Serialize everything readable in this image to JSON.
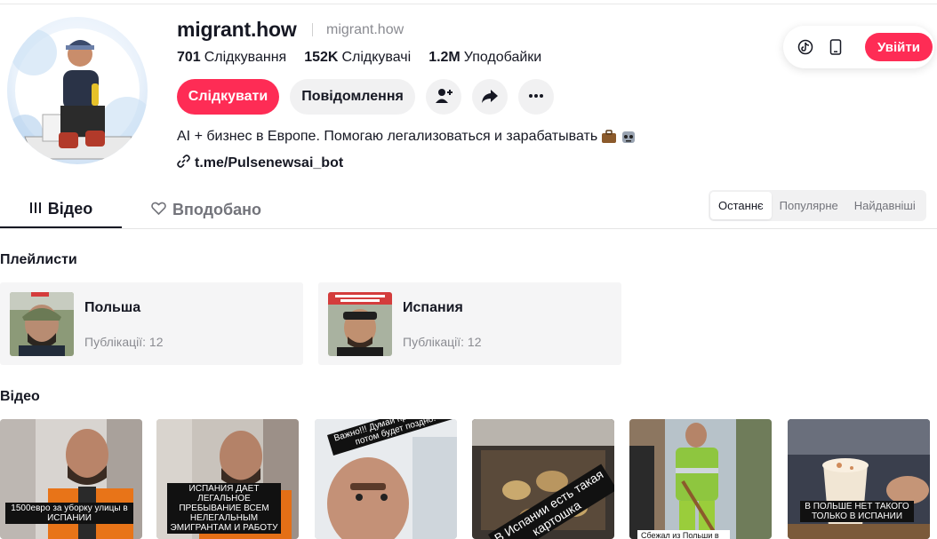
{
  "profile": {
    "username": "migrant.how",
    "nickname": "migrant.how",
    "stats": {
      "following_value": "701",
      "following_label": "Слідкування",
      "followers_value": "152K",
      "followers_label": "Слідкувачі",
      "likes_value": "1.2M",
      "likes_label": "Уподобайки"
    },
    "follow_label": "Слідкувати",
    "message_label": "Повідомлення",
    "bio": "AI + бизнес в Европе. Помогаю легализоваться и зарабатывать",
    "link": "t.me/Pulsenewsai_bot"
  },
  "header": {
    "login_label": "Увійти"
  },
  "tabs": {
    "videos": "Відео",
    "liked": "Вподобано"
  },
  "sort": {
    "latest": "Останнє",
    "popular": "Популярне",
    "oldest": "Найдавніші"
  },
  "sections": {
    "playlists": "Плейлисти",
    "videos": "Відео"
  },
  "playlists": [
    {
      "name": "Польша",
      "count": "Публікації: 12"
    },
    {
      "name": "Испания",
      "count": "Публікації: 12"
    }
  ],
  "videos": [
    {
      "caption": "1500евро за уборку улицы в ИСПАНИИ"
    },
    {
      "caption": "ИСПАНИЯ ДАЕТ ЛЕГАЛЬНОЕ ПРЕБЫВАНИЕ ВСЕМ НЕЛЕГАЛЬНЫМ ЭМИГРАНТАМ И РАБОТУ"
    },
    {
      "caption": "Важно!!! Думай прямо сейчас потом будет поздно!"
    },
    {
      "caption": "В Испании есть такая картошка"
    },
    {
      "caption": "Сбежал из Польши в"
    },
    {
      "caption": "В ПОЛЬШЕ НЕТ ТАКОГО ТОЛЬКО В ИСПАНИИ"
    }
  ],
  "colors": {
    "accent": "#fe2c55",
    "text": "#161823",
    "muted": "#8a8b91"
  }
}
